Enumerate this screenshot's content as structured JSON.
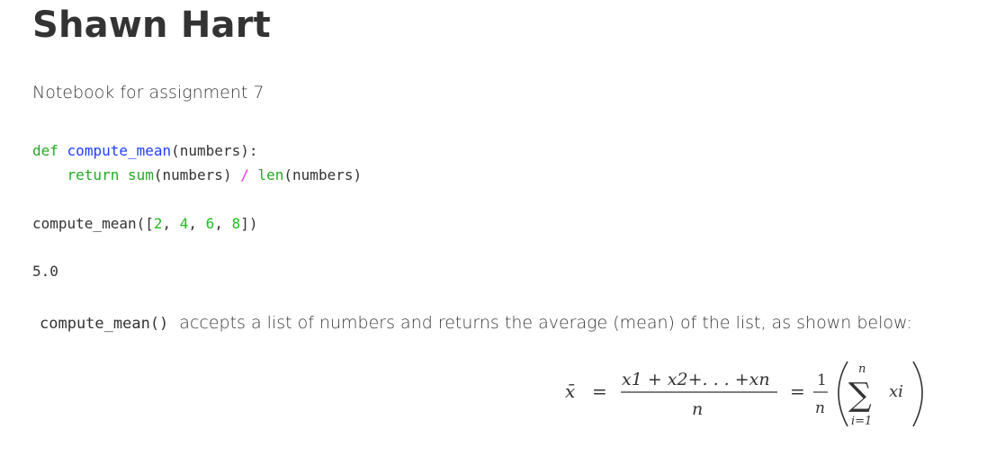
{
  "page": {
    "title": "Shawn Hart",
    "subtitle": "Notebook for assignment 7"
  },
  "code_cell_1": {
    "line1": {
      "kw_def": "def",
      "fn_name": "compute_mean",
      "params": "(numbers):"
    },
    "line2": {
      "indent": "    ",
      "kw_return": "return",
      "builtin_sum": "sum",
      "arg_sum": "(numbers)",
      "op_div": "/",
      "builtin_len": "len",
      "arg_len": "(numbers)"
    }
  },
  "code_cell_2": {
    "call": "compute_mean([",
    "n1": "2",
    "n2": "4",
    "n3": "6",
    "n4": "8",
    "sep": ", ",
    "close": "])"
  },
  "output_cell": {
    "value": "5.0"
  },
  "description": {
    "code_ref": "compute_mean()",
    "text": "accepts a list of numbers and returns the average (mean) of the list, as shown below:"
  },
  "formula": {
    "lhs": "x̄",
    "eq": "=",
    "numerator": "x1 + x2+. . . +xn",
    "denominator": "n",
    "frac_num": "1",
    "frac_den": "n",
    "sum_upper": "n",
    "sum_lower": "i=1",
    "sum_symbol": "∑",
    "summand": "xi"
  },
  "colors": {
    "text": "#333333",
    "keyword": "#22aa22",
    "function_name": "#1f3fff",
    "number": "#22bb22",
    "operator": "#ee33ee"
  }
}
